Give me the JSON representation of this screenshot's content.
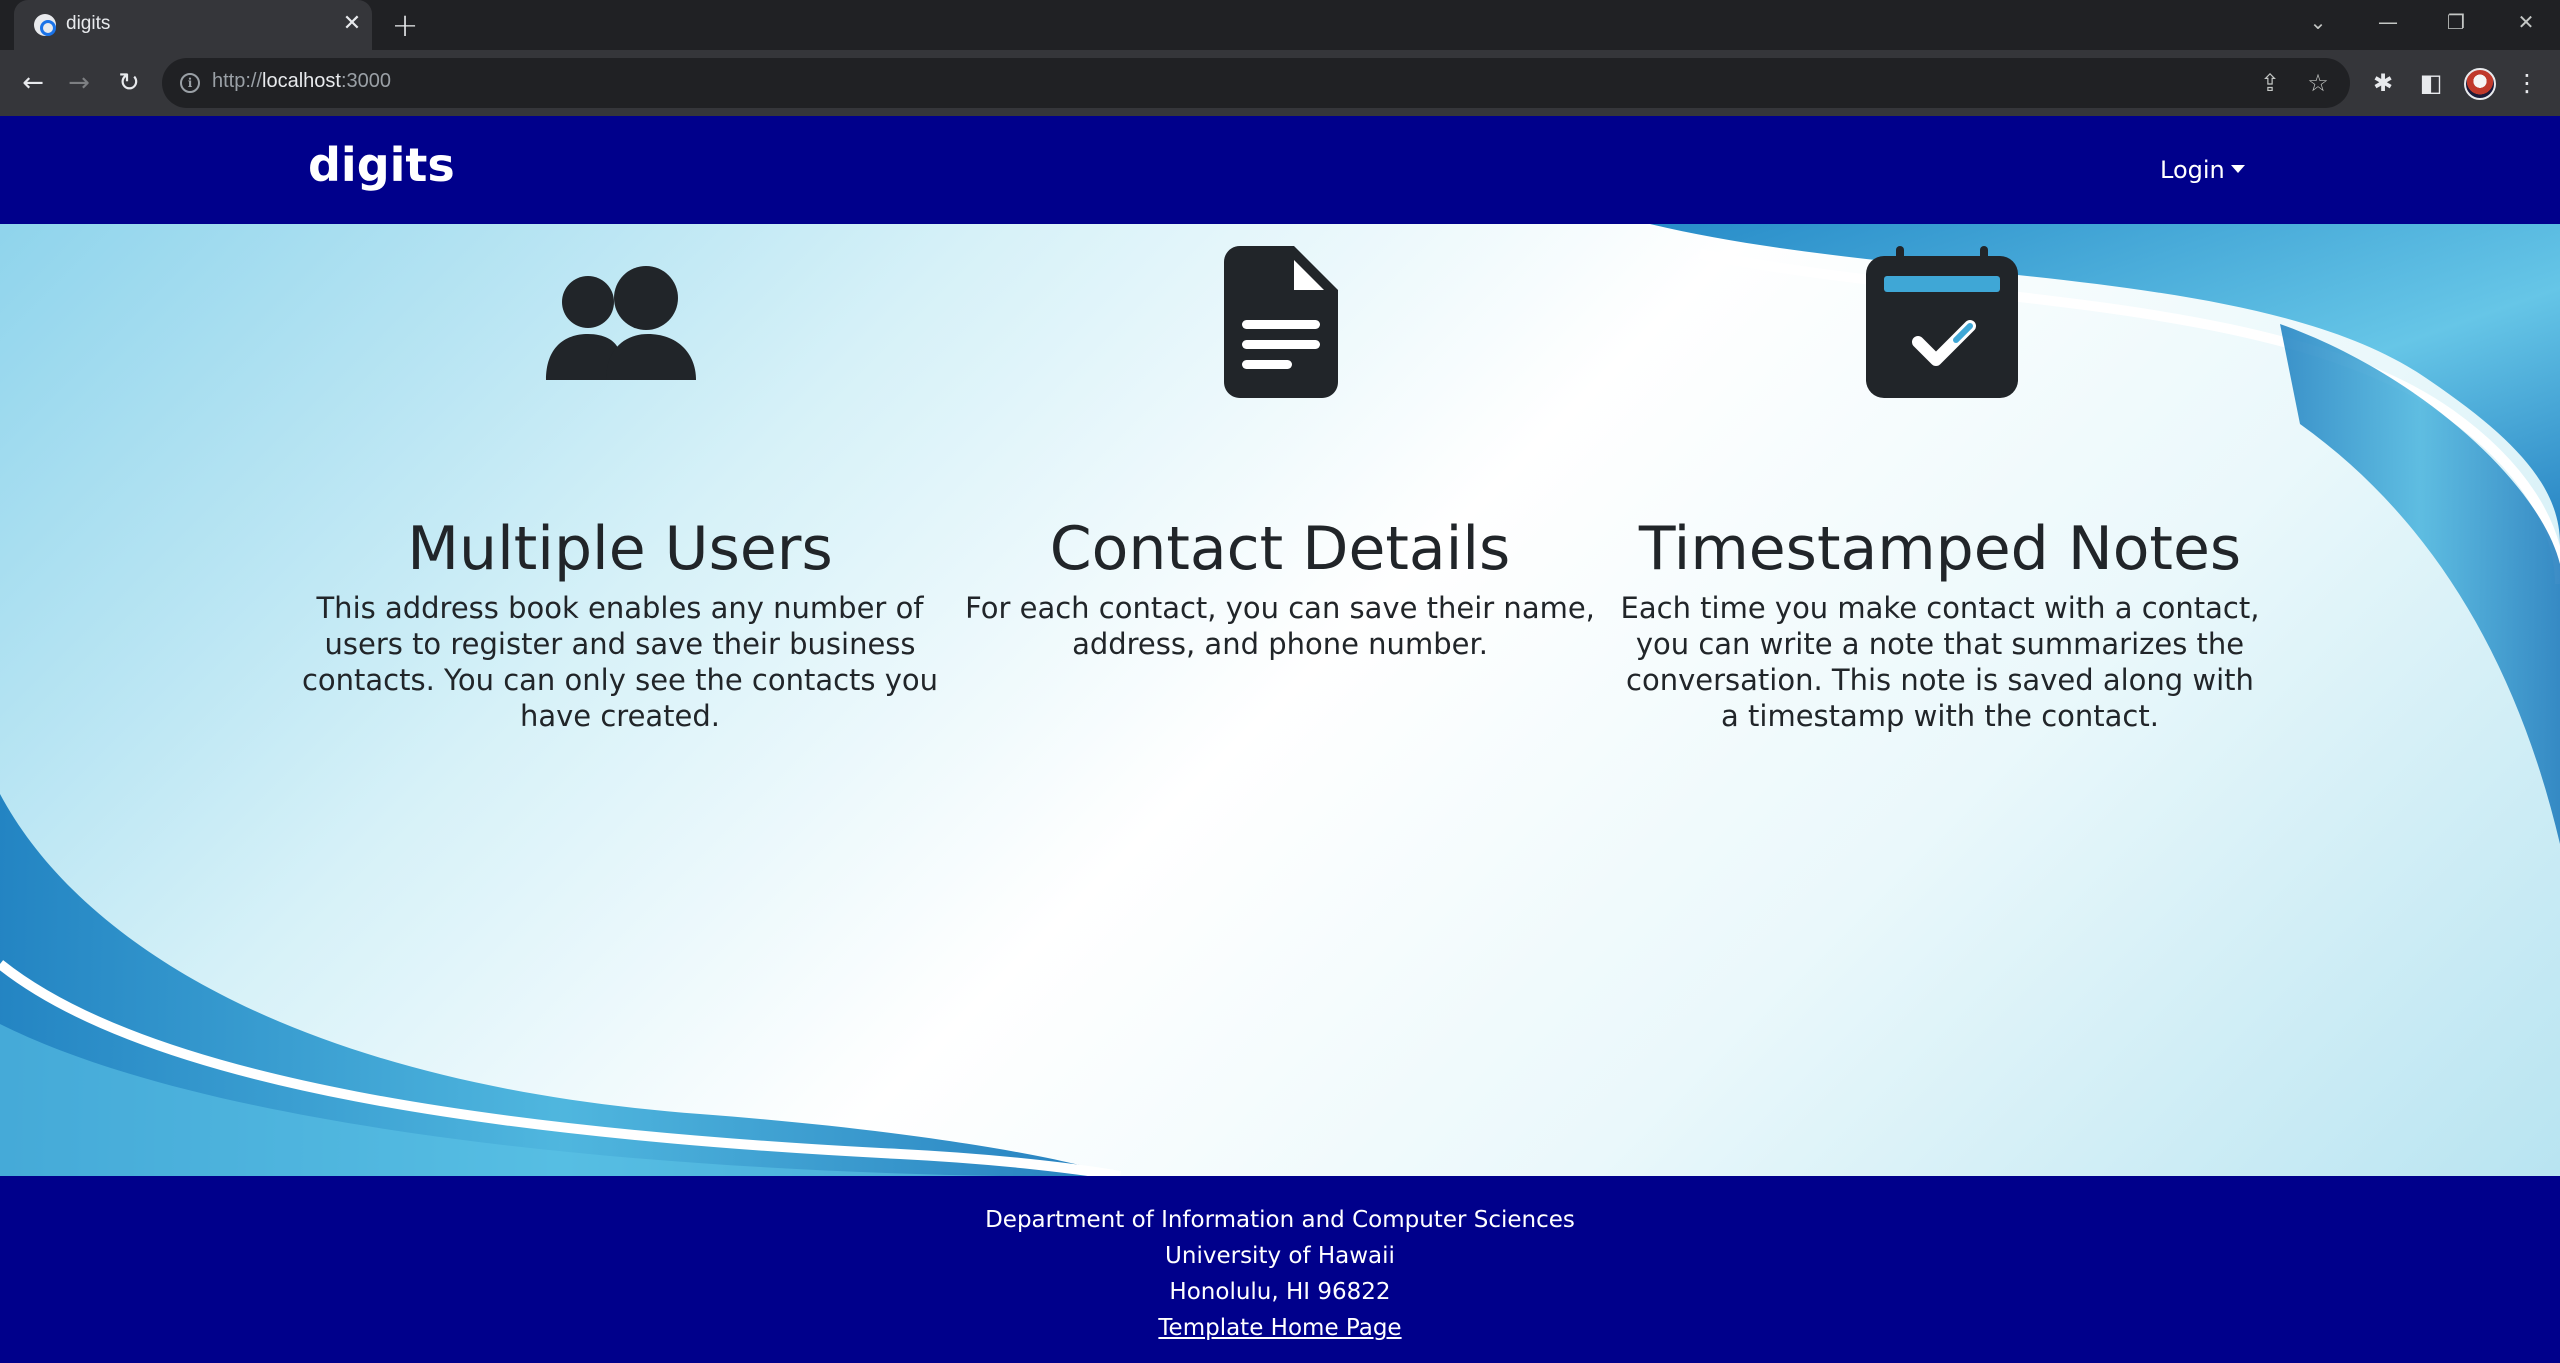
{
  "browser": {
    "tab_title": "digits",
    "url_scheme": "http://",
    "url_host": "localhost",
    "url_port": ":3000"
  },
  "navbar": {
    "brand": "digits",
    "login_label": "Login"
  },
  "features": [
    {
      "title": "Multiple Users",
      "text": "This address book enables any number of users to register and save their business contacts. You can only see the contacts you have created.",
      "icon": "users-icon"
    },
    {
      "title": "Contact Details",
      "text": "For each contact, you can save their name, address, and phone number.",
      "icon": "file-text-icon"
    },
    {
      "title": "Timestamped Notes",
      "text": "Each time you make contact with a contact, you can write a note that summarizes the conversation. This note is saved along with a timestamp with the contact.",
      "icon": "calendar-check-icon"
    }
  ],
  "footer": {
    "line1": "Department of Information and Computer Sciences",
    "line2": "University of Hawaii",
    "line3": "Honolulu, HI 96822",
    "link": "Template Home Page"
  },
  "colors": {
    "navbar_bg": "#00008b",
    "text_dark": "#212529"
  }
}
